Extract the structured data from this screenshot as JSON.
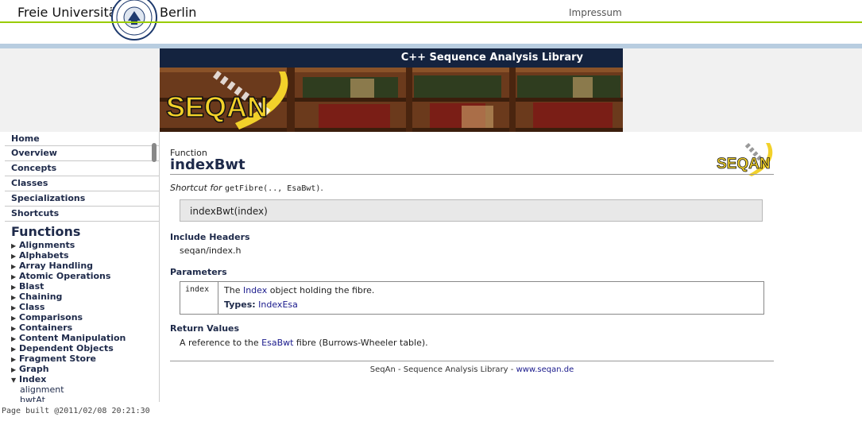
{
  "header": {
    "uni_left": "Freie Universität",
    "uni_right": "Berlin",
    "impressum": "Impressum",
    "accent_green": "#99cc00",
    "band_blue": "#b8cde0"
  },
  "banner": {
    "title": "C++ Sequence Analysis Library",
    "logo_text": "SEQAN"
  },
  "sidebar": {
    "nav": [
      "Home",
      "Overview",
      "Concepts",
      "Classes",
      "Specializations",
      "Shortcuts"
    ],
    "functions_title": "Functions",
    "functions": [
      {
        "label": "Alignments",
        "expanded": false
      },
      {
        "label": "Alphabets",
        "expanded": false
      },
      {
        "label": "Array Handling",
        "expanded": false
      },
      {
        "label": "Atomic Operations",
        "expanded": false
      },
      {
        "label": "Blast",
        "expanded": false
      },
      {
        "label": "Chaining",
        "expanded": false
      },
      {
        "label": "Class",
        "expanded": false
      },
      {
        "label": "Comparisons",
        "expanded": false
      },
      {
        "label": "Containers",
        "expanded": false
      },
      {
        "label": "Content Manipulation",
        "expanded": false
      },
      {
        "label": "Dependent Objects",
        "expanded": false
      },
      {
        "label": "Fragment Store",
        "expanded": false
      },
      {
        "label": "Graph",
        "expanded": false
      },
      {
        "label": "Index",
        "expanded": true
      }
    ],
    "index_subitems": [
      "alignment",
      "bwtAt"
    ]
  },
  "content": {
    "kind": "Function",
    "name": "indexBwt",
    "logo_text": "SEQAN",
    "shortcut_prefix": "Shortcut for",
    "shortcut_code": "getFibre(.., EsaBwt)",
    "shortcut_end": ".",
    "signature": "indexBwt(index)",
    "include_heading": "Include Headers",
    "include_value": "seqan/index.h",
    "params_heading": "Parameters",
    "param": {
      "name": "index",
      "desc_pre": "The",
      "desc_link": "Index",
      "desc_post": "object holding the fibre.",
      "types_label": "Types:",
      "types_value": "IndexEsa"
    },
    "return_heading": "Return Values",
    "return_pre": "A reference to the",
    "return_link": "EsaBwt",
    "return_post": "fibre (Burrows-Wheeler table).",
    "footer_text": "SeqAn - Sequence Analysis Library -",
    "footer_link": "www.seqan.de"
  },
  "status": "Page built @2011/02/08 20:21:30"
}
